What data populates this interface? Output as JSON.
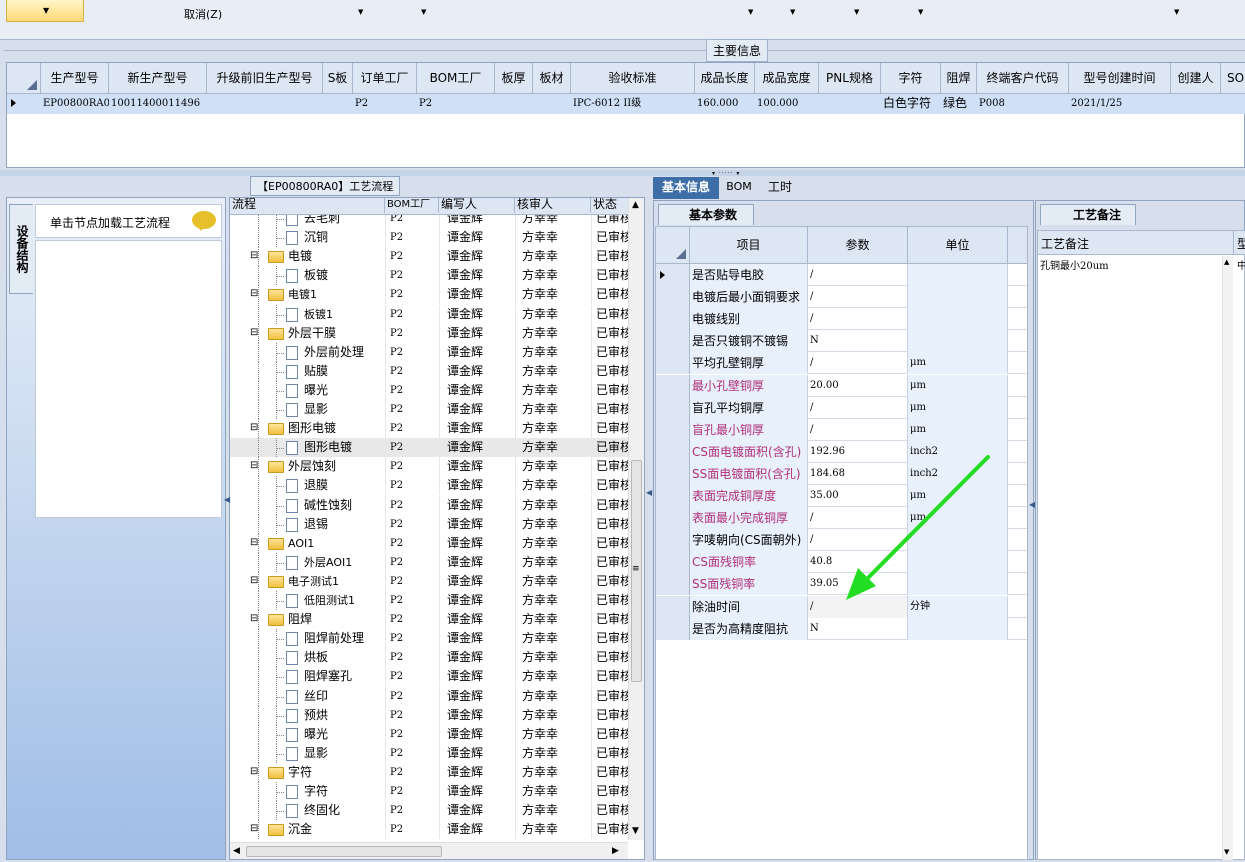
{
  "toolbar": {
    "cancel_label": "取消(Z)"
  },
  "main_info": {
    "title": "主要信息",
    "columns": [
      "生产型号",
      "新生产型号",
      "升级前旧生产型号",
      "S板",
      "订单工厂",
      "BOM工厂",
      "板厚",
      "板材",
      "验收标准",
      "成品长度",
      "成品宽度",
      "PNL规格",
      "字符",
      "阻焊",
      "终端客户代码",
      "型号创建时间",
      "创建人",
      "SO"
    ],
    "row": {
      "prod_model": "EP00800RA0",
      "new_model": "10011400011496",
      "old_model": "",
      "s_board": "",
      "order_factory": "P2",
      "bom_factory": "P2",
      "thickness": "",
      "material": "",
      "standard": "IPC-6012 II级",
      "length": "160.000",
      "width": "100.000",
      "pnl": "",
      "char": "白色字符",
      "solder": "绿色",
      "customer": "P008",
      "created": "2021/1/25",
      "creator": "",
      "so": ""
    }
  },
  "left_panel": {
    "vertical_tab": "设备结构",
    "hint": "单击节点加载工艺流程"
  },
  "flow": {
    "title": "【EP00800RA0】工艺流程",
    "columns": [
      "流程",
      "BOM工厂",
      "编写人",
      "核审人",
      "状态"
    ],
    "rows": [
      {
        "name": "去毛刺",
        "level": 1,
        "factory": "P2",
        "writer": "谭金辉",
        "reviewer": "方幸幸",
        "status": "已审核"
      },
      {
        "name": "沉铜",
        "level": 1,
        "factory": "P2",
        "writer": "谭金辉",
        "reviewer": "方幸幸",
        "status": "已审核"
      },
      {
        "name": "电镀",
        "level": 0,
        "factory": "P2",
        "writer": "谭金辉",
        "reviewer": "方幸幸",
        "status": "已审核"
      },
      {
        "name": "板镀",
        "level": 1,
        "factory": "P2",
        "writer": "谭金辉",
        "reviewer": "方幸幸",
        "status": "已审核"
      },
      {
        "name": "电镀1",
        "level": 0,
        "factory": "P2",
        "writer": "谭金辉",
        "reviewer": "方幸幸",
        "status": "已审核"
      },
      {
        "name": "板镀1",
        "level": 1,
        "factory": "P2",
        "writer": "谭金辉",
        "reviewer": "方幸幸",
        "status": "已审核"
      },
      {
        "name": "外层干膜",
        "level": 0,
        "factory": "P2",
        "writer": "谭金辉",
        "reviewer": "方幸幸",
        "status": "已审核"
      },
      {
        "name": "外层前处理",
        "level": 1,
        "factory": "P2",
        "writer": "谭金辉",
        "reviewer": "方幸幸",
        "status": "已审核"
      },
      {
        "name": "贴膜",
        "level": 1,
        "factory": "P2",
        "writer": "谭金辉",
        "reviewer": "方幸幸",
        "status": "已审核"
      },
      {
        "name": "曝光",
        "level": 1,
        "factory": "P2",
        "writer": "谭金辉",
        "reviewer": "方幸幸",
        "status": "已审核"
      },
      {
        "name": "显影",
        "level": 1,
        "factory": "P2",
        "writer": "谭金辉",
        "reviewer": "方幸幸",
        "status": "已审核"
      },
      {
        "name": "图形电镀",
        "level": 0,
        "factory": "P2",
        "writer": "谭金辉",
        "reviewer": "方幸幸",
        "status": "已审核"
      },
      {
        "name": "图形电镀",
        "level": 1,
        "factory": "P2",
        "writer": "谭金辉",
        "reviewer": "方幸幸",
        "status": "已审核",
        "selected": true
      },
      {
        "name": "外层蚀刻",
        "level": 0,
        "factory": "P2",
        "writer": "谭金辉",
        "reviewer": "方幸幸",
        "status": "已审核"
      },
      {
        "name": "退膜",
        "level": 1,
        "factory": "P2",
        "writer": "谭金辉",
        "reviewer": "方幸幸",
        "status": "已审核"
      },
      {
        "name": "碱性蚀刻",
        "level": 1,
        "factory": "P2",
        "writer": "谭金辉",
        "reviewer": "方幸幸",
        "status": "已审核"
      },
      {
        "name": "退锡",
        "level": 1,
        "factory": "P2",
        "writer": "谭金辉",
        "reviewer": "方幸幸",
        "status": "已审核"
      },
      {
        "name": "AOI1",
        "level": 0,
        "factory": "P2",
        "writer": "谭金辉",
        "reviewer": "方幸幸",
        "status": "已审核"
      },
      {
        "name": "外层AOI1",
        "level": 1,
        "factory": "P2",
        "writer": "谭金辉",
        "reviewer": "方幸幸",
        "status": "已审核"
      },
      {
        "name": "电子测试1",
        "level": 0,
        "factory": "P2",
        "writer": "谭金辉",
        "reviewer": "方幸幸",
        "status": "已审核"
      },
      {
        "name": "低阻测试1",
        "level": 1,
        "factory": "P2",
        "writer": "谭金辉",
        "reviewer": "方幸幸",
        "status": "已审核"
      },
      {
        "name": "阻焊",
        "level": 0,
        "factory": "P2",
        "writer": "谭金辉",
        "reviewer": "方幸幸",
        "status": "已审核"
      },
      {
        "name": "阻焊前处理",
        "level": 1,
        "factory": "P2",
        "writer": "谭金辉",
        "reviewer": "方幸幸",
        "status": "已审核"
      },
      {
        "name": "烘板",
        "level": 1,
        "factory": "P2",
        "writer": "谭金辉",
        "reviewer": "方幸幸",
        "status": "已审核"
      },
      {
        "name": "阻焊塞孔",
        "level": 1,
        "factory": "P2",
        "writer": "谭金辉",
        "reviewer": "方幸幸",
        "status": "已审核"
      },
      {
        "name": "丝印",
        "level": 1,
        "factory": "P2",
        "writer": "谭金辉",
        "reviewer": "方幸幸",
        "status": "已审核"
      },
      {
        "name": "预烘",
        "level": 1,
        "factory": "P2",
        "writer": "谭金辉",
        "reviewer": "方幸幸",
        "status": "已审核"
      },
      {
        "name": "曝光",
        "level": 1,
        "factory": "P2",
        "writer": "谭金辉",
        "reviewer": "方幸幸",
        "status": "已审核"
      },
      {
        "name": "显影",
        "level": 1,
        "factory": "P2",
        "writer": "谭金辉",
        "reviewer": "方幸幸",
        "status": "已审核"
      },
      {
        "name": "字符",
        "level": 0,
        "factory": "P2",
        "writer": "谭金辉",
        "reviewer": "方幸幸",
        "status": "已审核"
      },
      {
        "name": "字符",
        "level": 1,
        "factory": "P2",
        "writer": "谭金辉",
        "reviewer": "方幸幸",
        "status": "已审核"
      },
      {
        "name": "终固化",
        "level": 1,
        "factory": "P2",
        "writer": "谭金辉",
        "reviewer": "方幸幸",
        "status": "已审核"
      },
      {
        "name": "沉金",
        "level": 0,
        "factory": "P2",
        "writer": "谭金辉",
        "reviewer": "方幸幸",
        "status": "已审核"
      }
    ]
  },
  "tabs": {
    "basic": "基本信息",
    "bom": "BOM",
    "hours": "工时"
  },
  "params": {
    "title": "基本参数",
    "columns": [
      "项目",
      "参数",
      "单位"
    ],
    "rows": [
      {
        "item": "是否贴导电胶",
        "value": "/",
        "unit": "",
        "pink": false
      },
      {
        "item": "电镀后最小面铜要求",
        "value": "/",
        "unit": "",
        "pink": false
      },
      {
        "item": "电镀线别",
        "value": "/",
        "unit": "",
        "pink": false
      },
      {
        "item": "是否只镀铜不镀锡",
        "value": "N",
        "unit": "",
        "pink": false
      },
      {
        "item": "平均孔壁铜厚",
        "value": "/",
        "unit": "μm",
        "pink": false
      },
      {
        "item": "最小孔壁铜厚",
        "value": "20.00",
        "unit": "μm",
        "pink": true
      },
      {
        "item": "盲孔平均铜厚",
        "value": "/",
        "unit": "μm",
        "pink": false
      },
      {
        "item": "盲孔最小铜厚",
        "value": "/",
        "unit": "μm",
        "pink": true
      },
      {
        "item": "CS面电镀面积(含孔)",
        "value": "192.96",
        "unit": "inch2",
        "pink": true
      },
      {
        "item": "SS面电镀面积(含孔)",
        "value": "184.68",
        "unit": "inch2",
        "pink": true
      },
      {
        "item": "表面完成铜厚度",
        "value": "35.00",
        "unit": "μm",
        "pink": true
      },
      {
        "item": "表面最小完成铜厚",
        "value": "/",
        "unit": "μm",
        "pink": true
      },
      {
        "item": "字唛朝向(CS面朝外)",
        "value": "/",
        "unit": "",
        "pink": false
      },
      {
        "item": "CS面残铜率",
        "value": "40.8",
        "unit": "",
        "pink": true
      },
      {
        "item": "SS面残铜率",
        "value": "39.05",
        "unit": "",
        "pink": true
      },
      {
        "item": "除油时间",
        "value": "/",
        "unit": "分钟",
        "pink": false
      },
      {
        "item": "是否为高精度阻抗",
        "value": "N",
        "unit": "",
        "pink": false
      }
    ]
  },
  "remarks": {
    "title": "工艺备注",
    "column": "工艺备注",
    "column2": "型",
    "text": "孔铜最小20um",
    "text2": "中"
  },
  "colors": {
    "header_bg": "#dde7f4",
    "selected_row": "#cfe0f7",
    "pink": "#b0307a",
    "arrow": "#22dd22",
    "panel": "#d6dfeb",
    "tab_active": "#3d6ea8"
  }
}
